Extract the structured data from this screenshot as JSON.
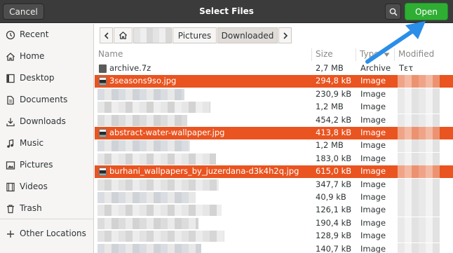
{
  "header": {
    "title": "Select Files",
    "cancel_label": "Cancel",
    "open_label": "Open"
  },
  "sidebar": {
    "items": [
      {
        "label": "Recent",
        "icon": "clock-icon"
      },
      {
        "label": "Home",
        "icon": "home-icon"
      },
      {
        "label": "Desktop",
        "icon": "desktop-icon"
      },
      {
        "label": "Documents",
        "icon": "document-icon"
      },
      {
        "label": "Downloads",
        "icon": "download-icon"
      },
      {
        "label": "Music",
        "icon": "music-icon"
      },
      {
        "label": "Pictures",
        "icon": "picture-icon"
      },
      {
        "label": "Videos",
        "icon": "video-icon"
      },
      {
        "label": "Trash",
        "icon": "trash-icon"
      },
      {
        "label": "Other Locations",
        "icon": "plus-icon"
      }
    ]
  },
  "pathbar": {
    "segments": [
      "Pictures",
      "Downloaded"
    ]
  },
  "columns": {
    "name": "Name",
    "size": "Size",
    "type": "Type",
    "modified": "Modified"
  },
  "files": [
    {
      "name": "archive.7z",
      "size": "2,7 MB",
      "type": "Archive",
      "modified": "Τετ",
      "selected": false,
      "icon": "archive-icon"
    },
    {
      "name": "3seasons9so.jpg",
      "size": "294,8 kB",
      "type": "Image",
      "modified": "",
      "selected": true,
      "icon": "image-icon"
    },
    {
      "name": "",
      "size": "230,9 kB",
      "type": "Image",
      "modified": "",
      "selected": false,
      "icon": ""
    },
    {
      "name": "",
      "size": "1,2 MB",
      "type": "Image",
      "modified": "",
      "selected": false,
      "icon": ""
    },
    {
      "name": "",
      "size": "454,2 kB",
      "type": "Image",
      "modified": "",
      "selected": false,
      "icon": ""
    },
    {
      "name": "abstract-water-wallpaper.jpg",
      "size": "413,8 kB",
      "type": "Image",
      "modified": "",
      "selected": true,
      "icon": "image-icon"
    },
    {
      "name": "",
      "size": "1,2 MB",
      "type": "Image",
      "modified": "",
      "selected": false,
      "icon": ""
    },
    {
      "name": "",
      "size": "183,0 kB",
      "type": "Image",
      "modified": "",
      "selected": false,
      "icon": ""
    },
    {
      "name": "burhani_wallpapers_by_juzerdana-d3k4h2q.jpg",
      "size": "615,0 kB",
      "type": "Image",
      "modified": "",
      "selected": true,
      "icon": "image-icon"
    },
    {
      "name": "",
      "size": "347,7 kB",
      "type": "Image",
      "modified": "",
      "selected": false,
      "icon": ""
    },
    {
      "name": "",
      "size": "40,9 kB",
      "type": "Image",
      "modified": "",
      "selected": false,
      "icon": ""
    },
    {
      "name": "",
      "size": "126,1 kB",
      "type": "Image",
      "modified": "",
      "selected": false,
      "icon": ""
    },
    {
      "name": "",
      "size": "190,4 kB",
      "type": "Image",
      "modified": "",
      "selected": false,
      "icon": ""
    },
    {
      "name": "",
      "size": "128,9 kB",
      "type": "Image",
      "modified": "",
      "selected": false,
      "icon": ""
    },
    {
      "name": "",
      "size": "140,7 kB",
      "type": "Image",
      "modified": "",
      "selected": false,
      "icon": ""
    }
  ],
  "colors": {
    "selection": "#e95420",
    "open_button": "#2fae34",
    "header": "#3b3b3b",
    "annotation_arrow": "#2b8ee8"
  }
}
